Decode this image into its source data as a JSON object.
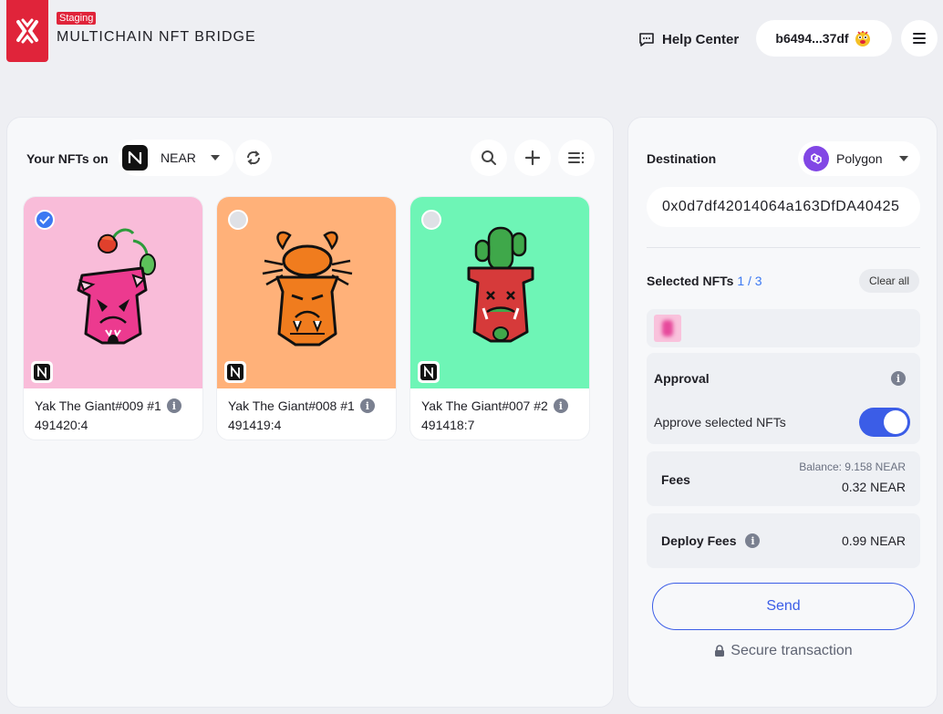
{
  "header": {
    "badge": "Staging",
    "title": "MULTICHAIN NFT BRIDGE",
    "help_center": "Help Center",
    "wallet": "b6494...37df",
    "brand_color": "#e0243a"
  },
  "collection": {
    "label": "Your NFTs on",
    "chain": "NEAR",
    "actions": [
      "refresh-icon",
      "search-icon",
      "plus-icon",
      "list-icon"
    ]
  },
  "nfts": [
    {
      "name": "Yak The Giant#009 #1",
      "id": "491420:4",
      "bg": "#f9bcd9",
      "selected": true
    },
    {
      "name": "Yak The Giant#008 #1",
      "id": "491419:4",
      "bg": "#ffb179",
      "selected": false
    },
    {
      "name": "Yak The Giant#007 #2",
      "id": "491418:7",
      "bg": "#6ef5b6",
      "selected": false
    }
  ],
  "destination": {
    "label": "Destination",
    "chain": "Polygon",
    "address": "0x0d7df42014064a163DfDA40425"
  },
  "selected": {
    "label": "Selected NFTs",
    "count": "1 / 3",
    "clear_all": "Clear all"
  },
  "approval": {
    "title": "Approval",
    "approve_label": "Approve selected NFTs",
    "approved": true
  },
  "fees": {
    "label": "Fees",
    "balance": "Balance: 9.158 NEAR",
    "value": "0.32 NEAR"
  },
  "deploy_fees": {
    "label": "Deploy Fees",
    "value": "0.99 NEAR"
  },
  "send_label": "Send",
  "secure_label": "Secure transaction",
  "accent_color": "#3b5de7"
}
